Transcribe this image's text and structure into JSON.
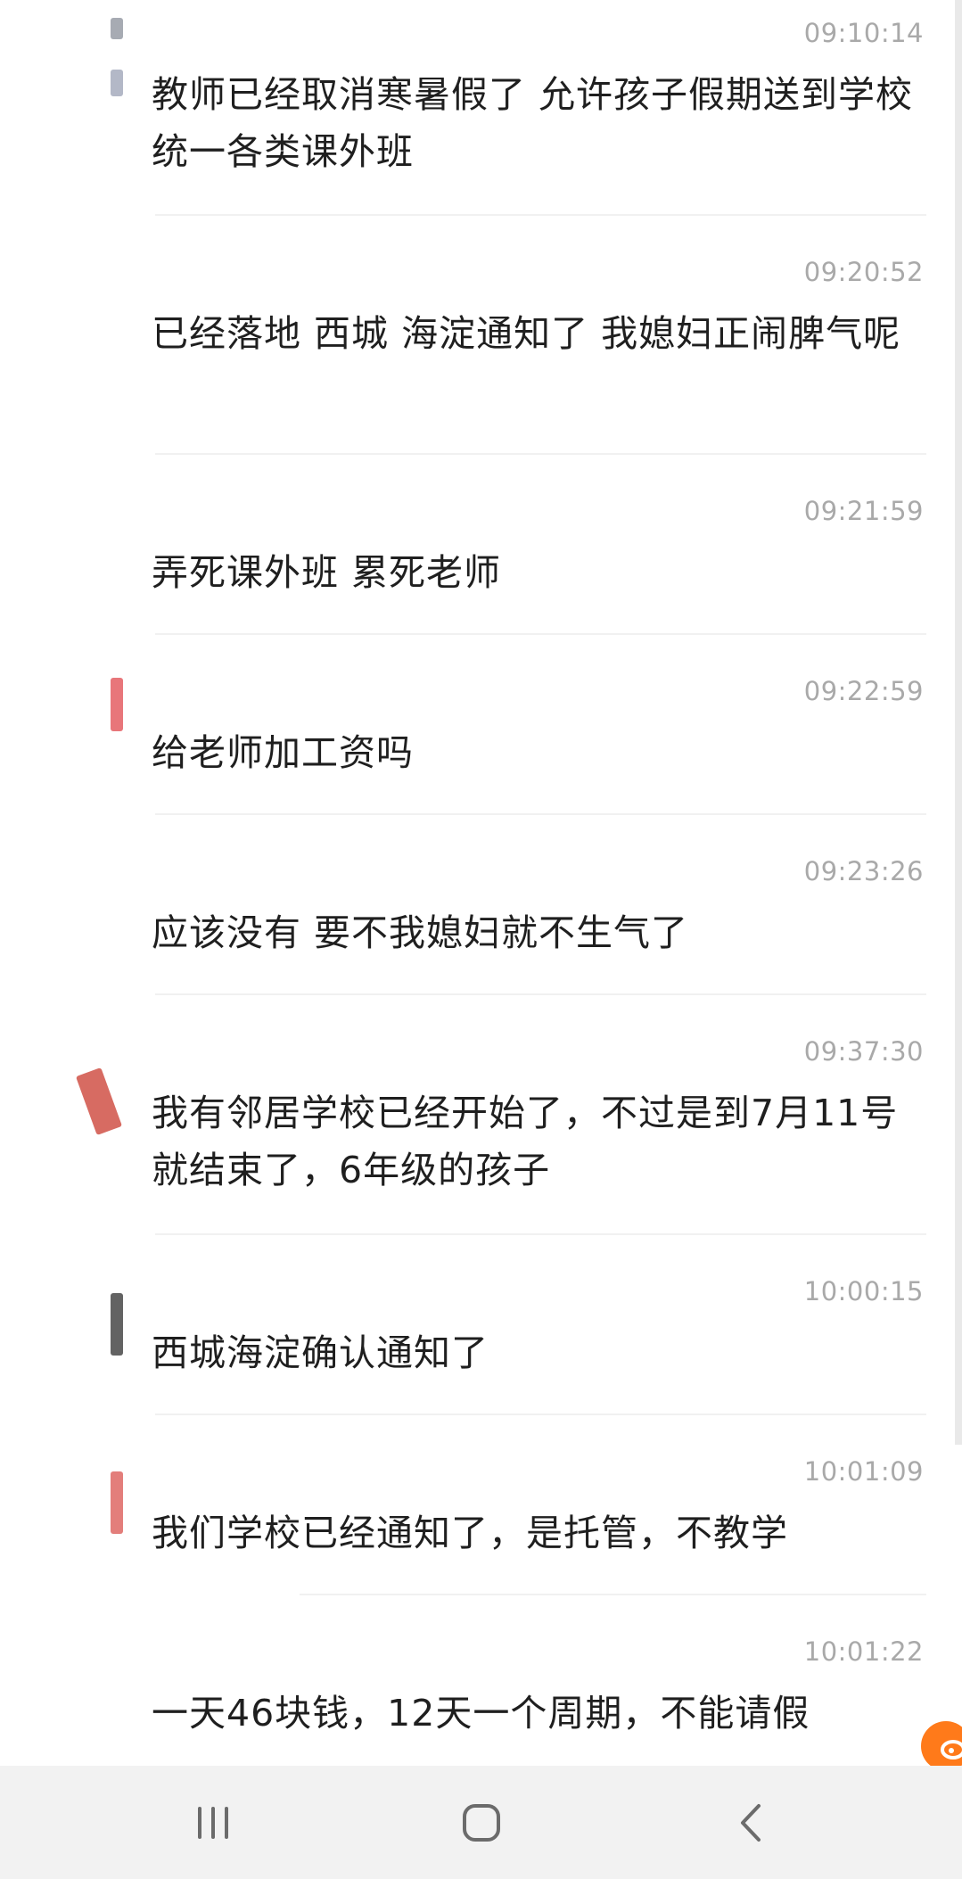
{
  "messages": [
    {
      "name": "",
      "time": "09:10:14",
      "text": "教师已经取消寒暑假了 允许孩子假期送到学校统一各类课外班"
    },
    {
      "name": "",
      "time": "09:20:52",
      "text": "已经落地 西城 海淀通知了 我媳妇正闹脾气呢"
    },
    {
      "name": "",
      "time": "09:21:59",
      "text": "弄死课外班 累死老师"
    },
    {
      "name": "",
      "time": "09:22:59",
      "text": "给老师加工资吗"
    },
    {
      "name": "",
      "time": "09:23:26",
      "text": "应该没有 要不我媳妇就不生气了"
    },
    {
      "name": "",
      "time": "09:37:30",
      "text": "我有邻居学校已经开始了，不过是到7月11号就结束了，6年级的孩子"
    },
    {
      "name": "",
      "time": "10:00:15",
      "text": "西城海淀确认通知了"
    },
    {
      "name": "",
      "time": "10:01:09",
      "text": "我们学校已经通知了，是托管，不教学"
    },
    {
      "name": "",
      "time": "10:01:22",
      "text": "一天46块钱，12天一个周期，不能请假"
    }
  ],
  "colors": {
    "text": "#1f1f1f",
    "time": "#a9a9a9",
    "divider": "#f1f1f1",
    "nav_bar": "#f2f2f2",
    "accent": "#ff7a1a"
  },
  "icons": {
    "nav_recent": "recent-apps-icon",
    "nav_home": "home-icon",
    "nav_back": "back-icon",
    "float_badge": "weibo-icon"
  }
}
